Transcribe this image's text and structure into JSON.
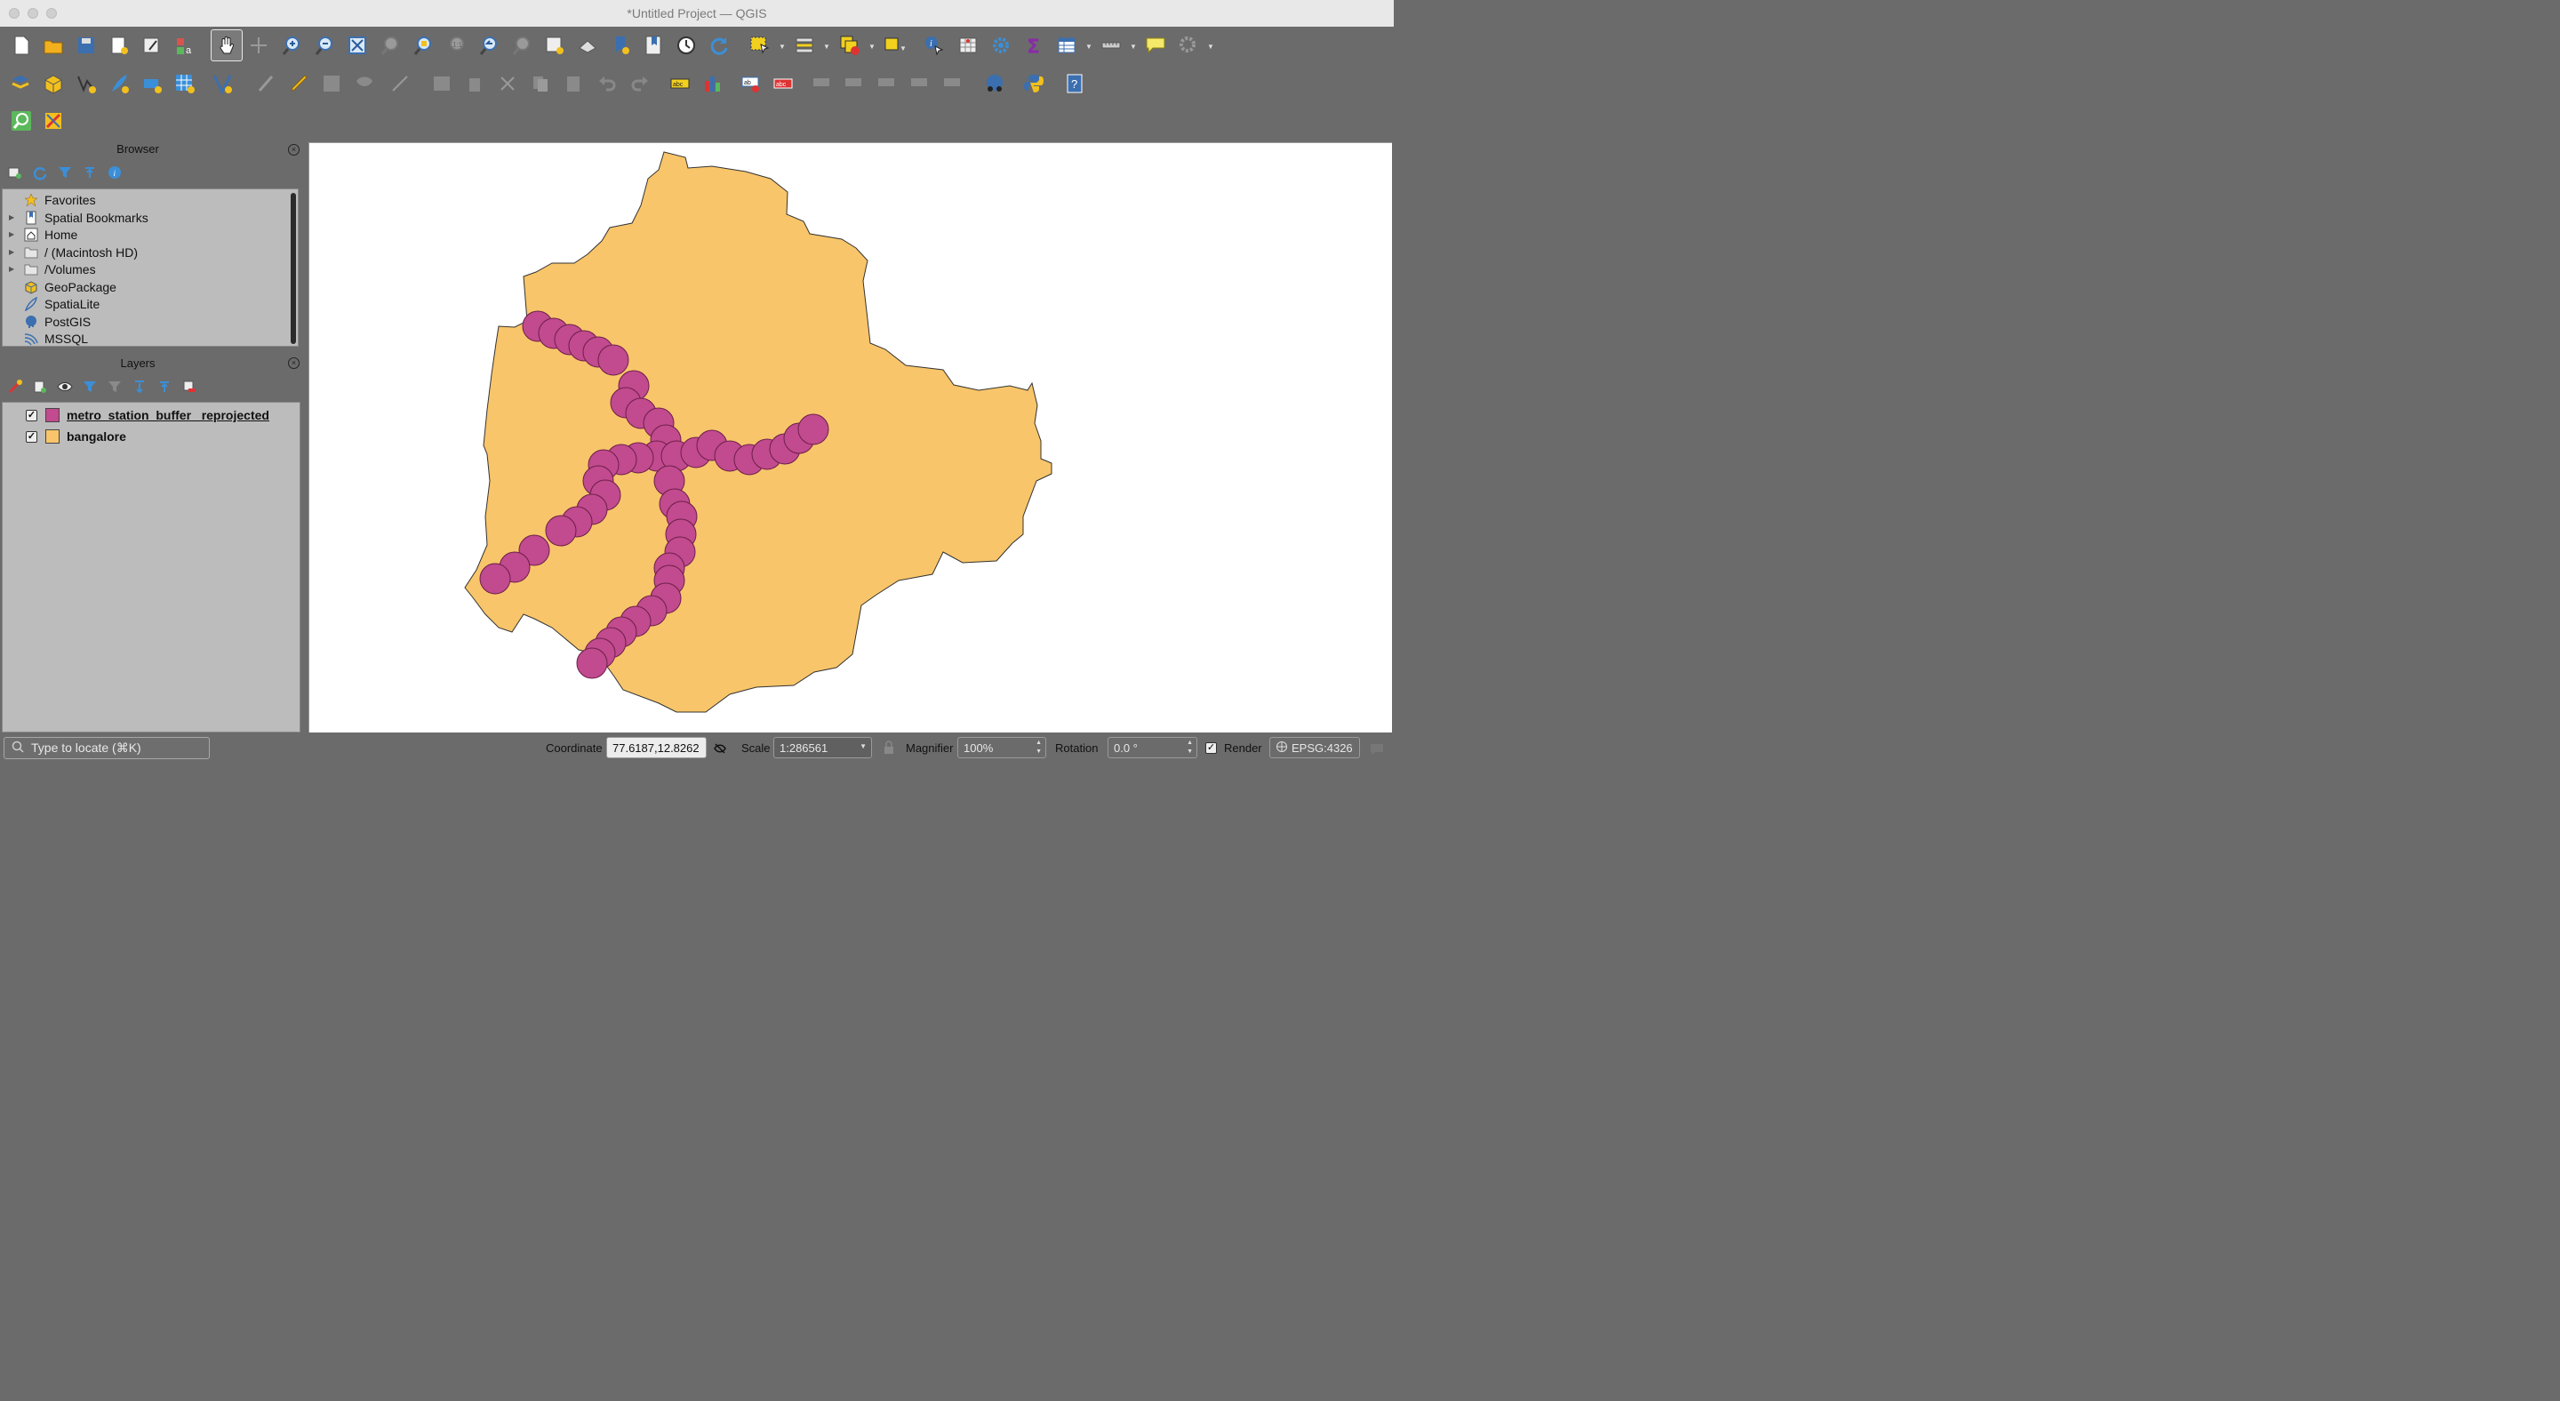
{
  "window": {
    "title": "*Untitled Project — QGIS"
  },
  "toolbar": {
    "row1_icons": [
      "new-project-icon",
      "open-project-icon",
      "save-project-icon",
      "new-print-layout-icon",
      "style-manager-icon",
      "new-3d-map-icon",
      "pan-map-icon",
      "pan-to-selection-icon",
      "zoom-in-icon",
      "zoom-out-icon",
      "zoom-full-icon",
      "zoom-to-selection-icon",
      "zoom-to-layer-icon",
      "zoom-native-icon",
      "zoom-last-icon",
      "zoom-next-icon",
      "new-map-view-icon",
      "new-3d-view-icon",
      "new-bookmark-icon",
      "show-bookmarks-icon",
      "temporal-controller-icon",
      "refresh-icon",
      "select-features-icon",
      "select-by-expression-icon",
      "deselect-icon",
      "select-location-icon",
      "identify-features-icon",
      "attribute-table-stat-icon",
      "settings-gear-icon",
      "statistics-sigma-icon",
      "open-attribute-table-icon",
      "measure-icon",
      "map-tips-icon",
      "processing-gear-icon"
    ],
    "row2_icons": [
      "data-source-manager-icon",
      "new-geopackage-layer-icon",
      "new-shapefile-layer-icon",
      "new-spatialite-layer-icon",
      "new-memory-layer-icon",
      "new-virtual-layer-icon",
      "digitize-with-segment-icon",
      "current-edits-icon",
      "toggle-editing-icon",
      "save-edits-icon",
      "add-feature-icon",
      "vertex-tool-icon",
      "modify-attributes-icon",
      "delete-selected-icon",
      "cut-features-icon",
      "copy-features-icon",
      "paste-features-icon",
      "undo-icon",
      "redo-icon",
      "label-tool-icon",
      "diagram-tool-icon",
      "pin-label-icon",
      "show-hide-labels-icon",
      "move-label-icon",
      "rotate-label-icon",
      "change-label-icon",
      "label-properties-icon",
      "georeferencer-icon",
      "python-console-icon",
      "help-icon"
    ],
    "row3_icons": [
      "locator-search-icon",
      "digitizing-tool-icon"
    ]
  },
  "browser": {
    "title": "Browser",
    "items": [
      {
        "label": "Favorites",
        "icon": "star-icon",
        "expandable": false
      },
      {
        "label": "Spatial Bookmarks",
        "icon": "bookmark-icon",
        "expandable": true
      },
      {
        "label": "Home",
        "icon": "home-icon",
        "expandable": true
      },
      {
        "label": "/ (Macintosh HD)",
        "icon": "folder-icon",
        "expandable": true
      },
      {
        "label": "/Volumes",
        "icon": "folder-icon",
        "expandable": true
      },
      {
        "label": "GeoPackage",
        "icon": "geopackage-icon",
        "expandable": false
      },
      {
        "label": "SpatiaLite",
        "icon": "spatialite-icon",
        "expandable": false
      },
      {
        "label": "PostGIS",
        "icon": "postgis-icon",
        "expandable": false
      },
      {
        "label": "MSSQL",
        "icon": "mssql-icon",
        "expandable": false
      }
    ]
  },
  "layers": {
    "title": "Layers",
    "items": [
      {
        "name": "metro_station_buffer _reprojected",
        "checked": true,
        "color": "#c24a8e",
        "active": true
      },
      {
        "name": "bangalore",
        "checked": true,
        "color": "#f8c56a",
        "active": false
      }
    ]
  },
  "map": {
    "background": "#ffffff",
    "region_fill": "#f8c56a",
    "buffer_fill": "#c24a8e"
  },
  "status": {
    "locate_placeholder": "Type to locate (⌘K)",
    "coordinate_label": "Coordinate",
    "coordinate_value": "77.6187,12.8262",
    "scale_label": "Scale",
    "scale_value": "1:286561",
    "magnifier_label": "Magnifier",
    "magnifier_value": "100%",
    "rotation_label": "Rotation",
    "rotation_value": "0.0 °",
    "render_label": "Render",
    "render_checked": true,
    "crs_value": "EPSG:4326"
  }
}
